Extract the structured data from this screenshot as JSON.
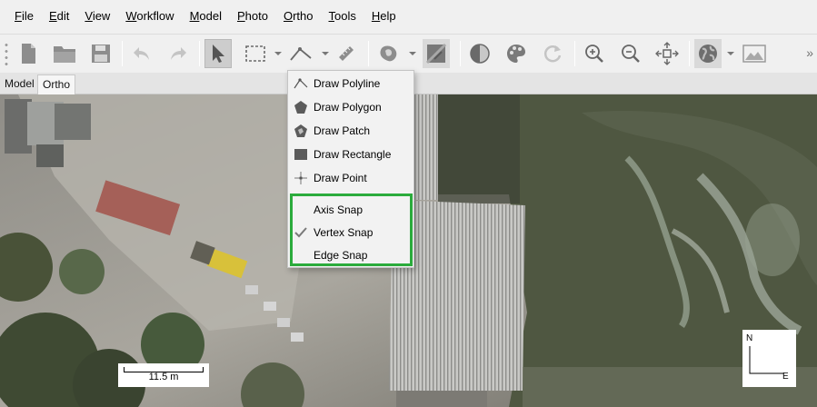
{
  "menubar": {
    "items": [
      "File",
      "Edit",
      "View",
      "Workflow",
      "Model",
      "Photo",
      "Ortho",
      "Tools",
      "Help"
    ]
  },
  "toolbar": {
    "buttons": [
      "new-document-icon",
      "open-folder-icon",
      "save-icon",
      "undo-icon",
      "redo-icon",
      "select-arrow-icon",
      "rectangle-selection-icon",
      "draw-polyline-icon",
      "ruler-icon",
      "shape-layers-icon",
      "orthophoto-edit-icon",
      "contrast-icon",
      "palette-icon",
      "refresh-icon",
      "zoom-in-icon",
      "zoom-out-icon",
      "reset-view-icon",
      "globe-icon",
      "image-icon"
    ],
    "overflow_label": "»"
  },
  "tabs": [
    "Model",
    "Ortho"
  ],
  "active_tab": "Ortho",
  "draw_menu": {
    "items": [
      {
        "label": "Draw Polyline",
        "icon": "polyline-icon"
      },
      {
        "label": "Draw Polygon",
        "icon": "polygon-icon"
      },
      {
        "label": "Draw Patch",
        "icon": "patch-icon"
      },
      {
        "label": "Draw Rectangle",
        "icon": "rectangle-icon"
      },
      {
        "label": "Draw Point",
        "icon": "point-icon"
      }
    ],
    "snap_items": [
      {
        "label": "Axis Snap",
        "checked": false
      },
      {
        "label": "Vertex Snap",
        "checked": true
      },
      {
        "label": "Edge Snap",
        "checked": false
      }
    ],
    "highlight_color": "#2bab3c"
  },
  "viewport": {
    "scale_label": "11.5 m",
    "compass_north": "N",
    "compass_east": "E"
  }
}
